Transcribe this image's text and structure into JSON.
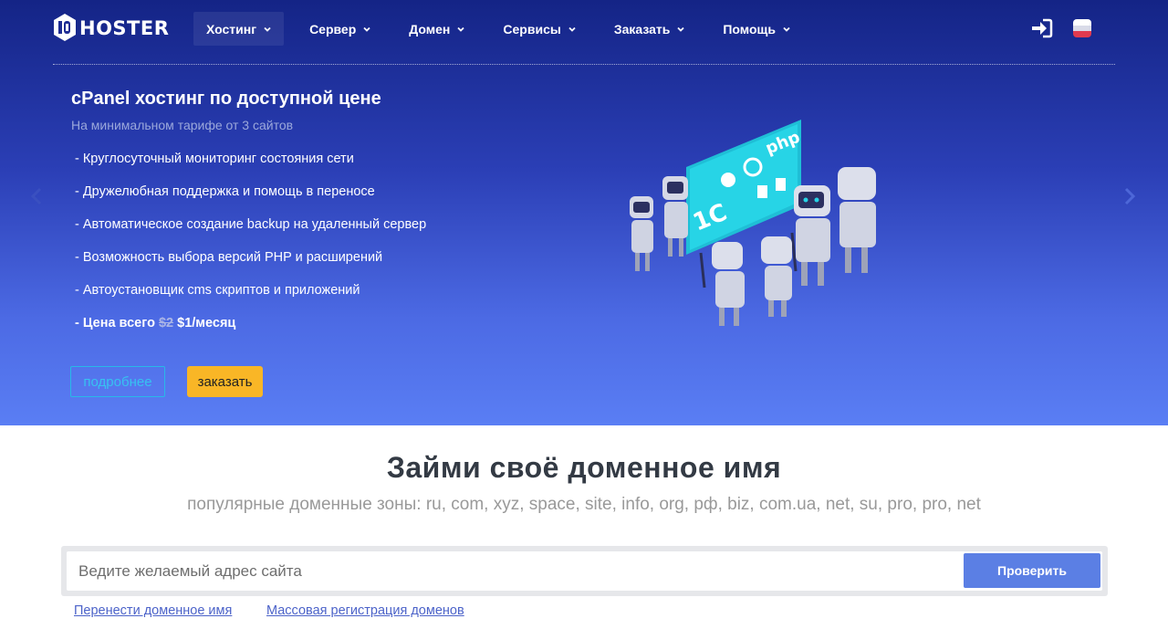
{
  "brand": {
    "logo_text": "HOSTER"
  },
  "nav": {
    "items": [
      {
        "label": "Хостинг",
        "active": true
      },
      {
        "label": "Сервер",
        "active": false
      },
      {
        "label": "Домен",
        "active": false
      },
      {
        "label": "Сервисы",
        "active": false
      },
      {
        "label": "Заказать",
        "active": false
      },
      {
        "label": "Помощь",
        "active": false
      }
    ],
    "icons": {
      "login": "login-icon",
      "language": "russian-flag-icon",
      "menu_chevron": "chevron-down-icon"
    }
  },
  "hero": {
    "title": "cPanel хостинг по доступной цене",
    "subtitle": "На минимальном тарифе от 3 сайтов",
    "features": [
      "- Круглосуточный мониторинг состояния сети",
      "- Дружелюбная поддержка и помощь в переносе",
      "- Автоматическое создание backup на удаленный сервер",
      "- Возможность выбора версий PHP и расширений",
      "- Автоустановщик cms скриптов и приложений"
    ],
    "price_prefix": "- Цена всего ",
    "price_old": "$2",
    "price_new": "$1/месяц",
    "more_button": "подробнее",
    "order_button": "заказать",
    "illustration_board_text": {
      "php": "php",
      "one_c": "1C"
    }
  },
  "domain": {
    "title": "Займи своё доменное имя",
    "zones": "популярные доменные зоны: ru, com, xyz, space, site, info, org, рф, biz, com.ua, net, su, pro, pro, net",
    "search_placeholder": "Ведите желаемый адрес сайта",
    "search_button": "Проверить",
    "links": {
      "transfer": "Перенести доменное имя",
      "bulk": "Массовая регистрация доменов"
    }
  },
  "colors": {
    "hero_gradient_top": "#142486",
    "hero_gradient_bottom": "#5a7ef4",
    "accent_yellow": "#f9b626",
    "accent_cyan": "#28b9e8",
    "button_blue": "#5b7fe4",
    "link_blue": "#4c63c9"
  }
}
